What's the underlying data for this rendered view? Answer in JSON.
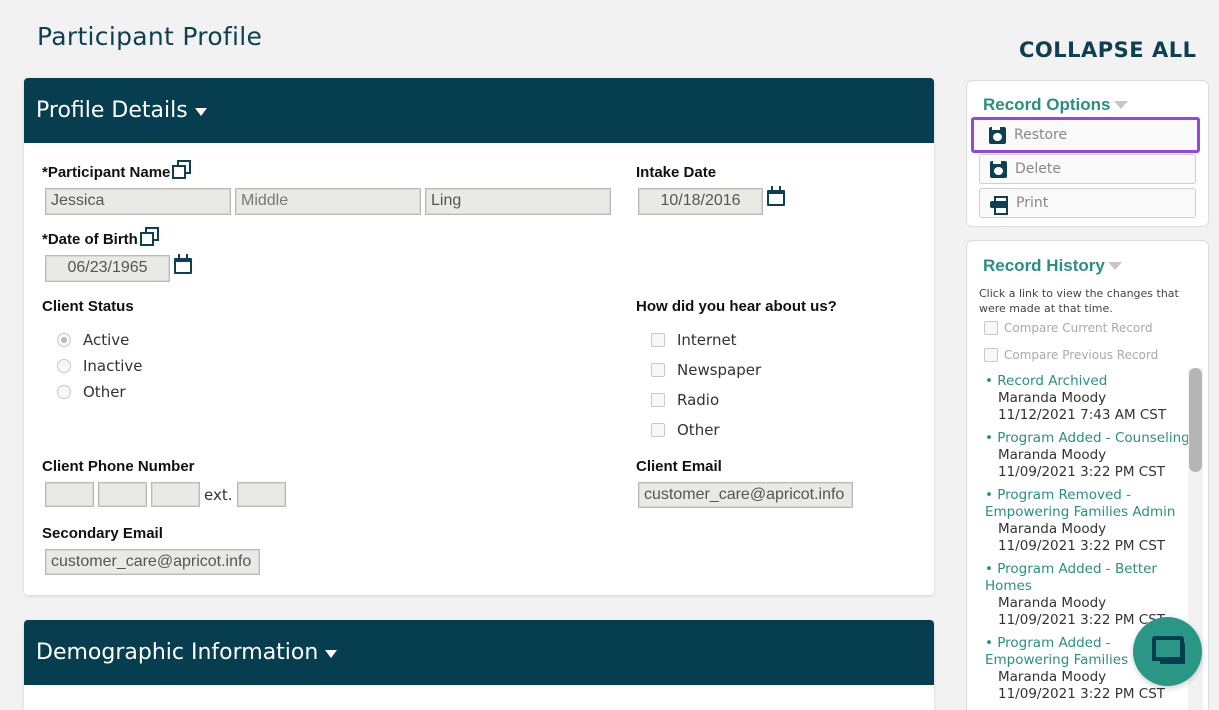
{
  "page_title": "Participant Profile",
  "collapse_all": "COLLAPSE ALL",
  "profile": {
    "header": "Profile Details",
    "participant_name_label": "*Participant Name",
    "first_name": "Jessica",
    "middle_placeholder": "Middle",
    "last_name": "Ling",
    "intake_date_label": "Intake Date",
    "intake_date": "10/18/2016",
    "dob_label": "*Date of Birth",
    "dob": "06/23/1965",
    "client_status_label": "Client Status",
    "status_options": [
      "Active",
      "Inactive",
      "Other"
    ],
    "status_selected": "Active",
    "hear_label": "How did you hear about us?",
    "hear_options": [
      "Internet",
      "Newspaper",
      "Radio",
      "Other"
    ],
    "phone_label": "Client Phone Number",
    "ext_label": "ext.",
    "email_label": "Client Email",
    "email": "customer_care@apricot.info",
    "secondary_email_label": "Secondary Email",
    "secondary_email": "customer_care@apricot.info"
  },
  "demographic": {
    "header": "Demographic Information"
  },
  "record_options": {
    "title": "Record Options",
    "restore": "Restore",
    "delete": "Delete",
    "print": "Print"
  },
  "record_history": {
    "title": "Record History",
    "hint": "Click a link to view the changes that were made at that time.",
    "compare_current": "Compare Current Record",
    "compare_previous": "Compare Previous Record",
    "items": [
      {
        "link": "• Record Archived",
        "user": "Maranda Moody",
        "time": "11/12/2021 7:43 AM CST"
      },
      {
        "link": "• Program Added - Counseling",
        "user": "Maranda Moody",
        "time": "11/09/2021 3:22 PM CST"
      },
      {
        "link": "• Program Removed - Empowering Families Admin",
        "user": "Maranda Moody",
        "time": "11/09/2021 3:22 PM CST"
      },
      {
        "link": "• Program Added - Better Homes",
        "user": "Maranda Moody",
        "time": "11/09/2021 3:22 PM CST"
      },
      {
        "link": "• Program Added - Empowering Families",
        "user": "Maranda Moody",
        "time": "11/09/2021 3:22 PM CST"
      }
    ]
  },
  "icons": {
    "copy": "copy-icon",
    "calendar": "calendar-icon",
    "restore": "save-disk-icon",
    "print": "printer-icon",
    "chat": "chat-bubble-icon"
  },
  "colors": {
    "header_bg": "#063d4f",
    "accent_teal": "#2a8f82",
    "highlight": "#9545e0"
  }
}
